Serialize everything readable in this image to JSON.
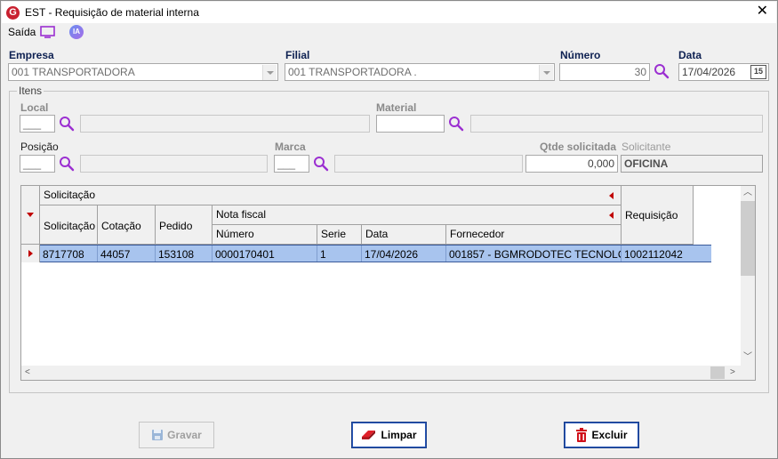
{
  "window": {
    "title": "EST - Requisição de material interna",
    "logo_letter": "G",
    "close_glyph": "✕"
  },
  "toolbar": {
    "saida_label": "Saída",
    "ia_label": "IA"
  },
  "form": {
    "empresa": {
      "label": "Empresa",
      "value": "001 TRANSPORTADORA"
    },
    "filial": {
      "label": "Filial",
      "value": "001 TRANSPORTADORA ."
    },
    "numero": {
      "label": "Número",
      "value": "30"
    },
    "data": {
      "label": "Data",
      "value": "17/04/2026",
      "calendar_label": "15"
    }
  },
  "itens": {
    "group_label": "Itens",
    "local": {
      "label": "Local",
      "code": "___",
      "description": ""
    },
    "material": {
      "label": "Material",
      "code": "",
      "description": ""
    },
    "posicao": {
      "label": "Posição",
      "code": "___",
      "description": ""
    },
    "marca": {
      "label": "Marca",
      "code": "___",
      "description": ""
    },
    "qtde_solicitada": {
      "label": "Qtde solicitada",
      "value": "0,000"
    },
    "solicitante": {
      "label": "Solicitante",
      "value": "OFICINA"
    }
  },
  "grid": {
    "band_solicitacao": "Solicitação",
    "band_nota_fiscal": "Nota fiscal",
    "columns": {
      "solicitacao": "Solicitação",
      "cotacao": "Cotação",
      "pedido": "Pedido",
      "numero": "Número",
      "serie": "Serie",
      "data": "Data",
      "fornecedor": "Fornecedor",
      "requisicao": "Requisição"
    },
    "rows": [
      {
        "solicitacao": "8717708",
        "cotacao": "44057",
        "pedido": "153108",
        "numero": "0000170401",
        "serie": "1",
        "data": "17/04/2026",
        "fornecedor": "001857 - BGMRODOTEC TECNOLOG...",
        "requisicao": "1002112042"
      }
    ]
  },
  "buttons": {
    "gravar": "Gravar",
    "limpar": "Limpar",
    "excluir": "Excluir"
  },
  "colors": {
    "label_blue": "#0e2152",
    "selection": "#a8c4ee",
    "accent_purple": "#8a2be2",
    "red": "#c00000"
  }
}
